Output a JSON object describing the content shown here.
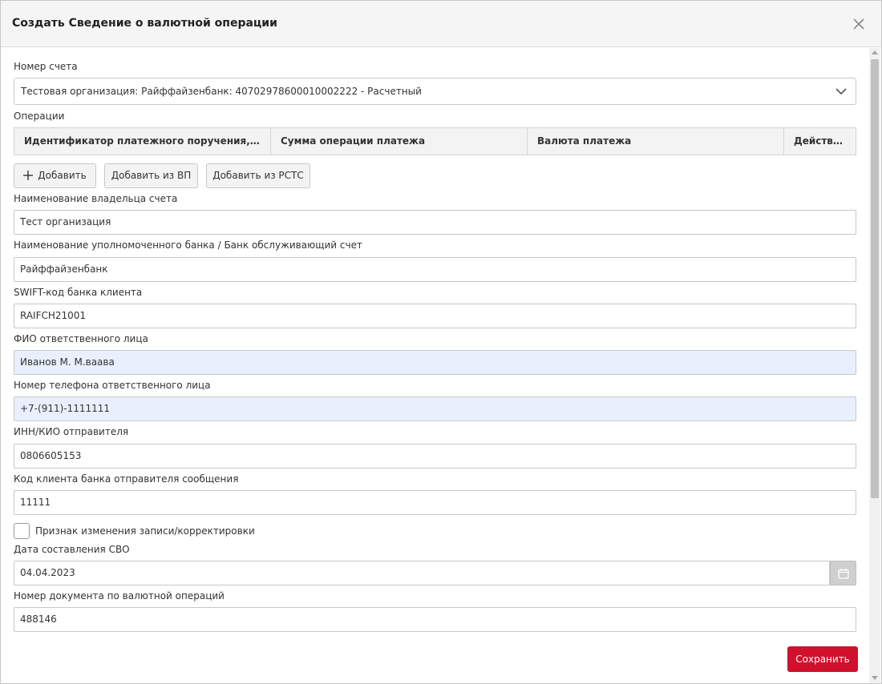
{
  "dialog": {
    "title": "Создать Сведение о валютной операции"
  },
  "account": {
    "label": "Номер счета",
    "value": "Тестовая организация: Райффайзенбанк: 40702978600010002222 - Расчетный"
  },
  "operations": {
    "label": "Операции",
    "columns": [
      "Идентификатор платежного поручения, к кото...",
      "Сумма операции платежа",
      "Валюта платежа",
      "Действие"
    ]
  },
  "buttons": {
    "add": "Добавить",
    "add_from_vp": "Добавить из ВП",
    "add_from_rsts": "Добавить из РСТС",
    "save": "Сохранить"
  },
  "fields": {
    "owner_name": {
      "label": "Наименование владельца счета",
      "value": "Тест организация"
    },
    "bank_name": {
      "label": "Наименование уполномоченного банка / Банк обслуживающий счет",
      "value": "Райффайзенбанк"
    },
    "swift": {
      "label": "SWIFT-код банка клиента",
      "value": "RAIFCH21001"
    },
    "responsible_name": {
      "label": "ФИО ответственного лица",
      "value": "Иванов М. М.вaава"
    },
    "responsible_phone": {
      "label": "Номер телефона ответственного лица",
      "value": "+7-(911)-1111111"
    },
    "inn": {
      "label": "ИНН/КИО отправителя",
      "value": "0806605153"
    },
    "client_code": {
      "label": "Код клиента банка отправителя сообщения",
      "value": "11111"
    },
    "correction": {
      "label": "Признак изменения записи/корректировки"
    },
    "svo_date": {
      "label": "Дата составления СВО",
      "value": "04.04.2023"
    },
    "doc_number": {
      "label": "Номер документа по валютной операций",
      "value": "488146"
    }
  },
  "colors": {
    "primary": "#d0102d",
    "autofill": "#e8f0fe"
  }
}
